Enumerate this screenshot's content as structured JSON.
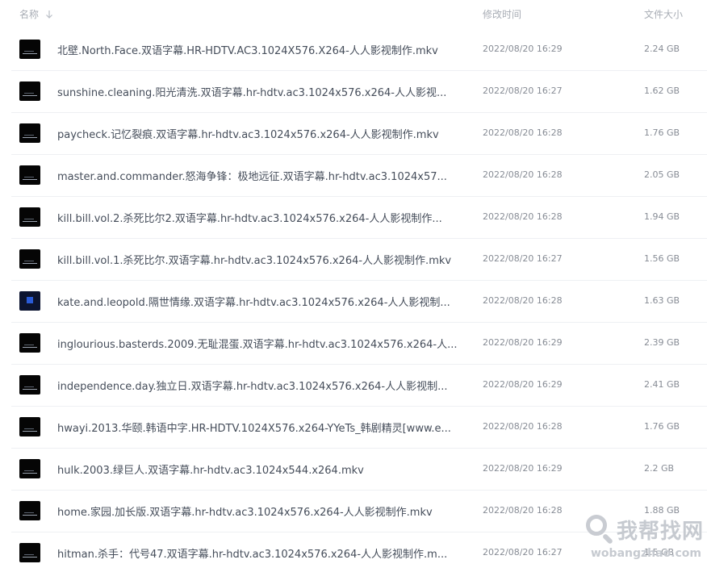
{
  "header": {
    "name_label": "名称",
    "time_label": "修改时间",
    "size_label": "文件大小"
  },
  "files": [
    {
      "name": "北壁.North.Face.双语字幕.HR-HDTV.AC3.1024X576.X264-人人影视制作.mkv",
      "time": "2022/08/20 16:29",
      "size": "2.24 GB",
      "thumb": "dark"
    },
    {
      "name": "sunshine.cleaning.阳光清洗.双语字幕.hr-hdtv.ac3.1024x576.x264-人人影视...",
      "time": "2022/08/20 16:27",
      "size": "1.62 GB",
      "thumb": "dark"
    },
    {
      "name": "paycheck.记忆裂痕.双语字幕.hr-hdtv.ac3.1024x576.x264-人人影视制作.mkv",
      "time": "2022/08/20 16:28",
      "size": "1.76 GB",
      "thumb": "dark"
    },
    {
      "name": "master.and.commander.怒海争锋：极地远征.双语字幕.hr-hdtv.ac3.1024x57...",
      "time": "2022/08/20 16:28",
      "size": "2.05 GB",
      "thumb": "dark"
    },
    {
      "name": "kill.bill.vol.2.杀死比尔2.双语字幕.hr-hdtv.ac3.1024x576.x264-人人影视制作...",
      "time": "2022/08/20 16:28",
      "size": "1.94 GB",
      "thumb": "dark"
    },
    {
      "name": "kill.bill.vol.1.杀死比尔.双语字幕.hr-hdtv.ac3.1024x576.x264-人人影视制作.mkv",
      "time": "2022/08/20 16:27",
      "size": "1.56 GB",
      "thumb": "dark"
    },
    {
      "name": "kate.and.leopold.隔世情缘.双语字幕.hr-hdtv.ac3.1024x576.x264-人人影视制...",
      "time": "2022/08/20 16:28",
      "size": "1.63 GB",
      "thumb": "blue"
    },
    {
      "name": "inglourious.basterds.2009.无耻混蛋.双语字幕.hr-hdtv.ac3.1024x576.x264-人...",
      "time": "2022/08/20 16:29",
      "size": "2.39 GB",
      "thumb": "dark"
    },
    {
      "name": "independence.day.独立日.双语字幕.hr-hdtv.ac3.1024x576.x264-人人影视制...",
      "time": "2022/08/20 16:29",
      "size": "2.41 GB",
      "thumb": "dark"
    },
    {
      "name": "hwayi.2013.华颐.韩语中字.HR-HDTV.1024X576.x264-YYeTs_韩剧精灵[www.e...",
      "time": "2022/08/20 16:28",
      "size": "1.76 GB",
      "thumb": "dark"
    },
    {
      "name": "hulk.2003.绿巨人.双语字幕.hr-hdtv.ac3.1024x544.x264.mkv",
      "time": "2022/08/20 16:29",
      "size": "2.2 GB",
      "thumb": "dark"
    },
    {
      "name": "home.家园.加长版.双语字幕.hr-hdtv.ac3.1024x576.x264-人人影视制作.mkv",
      "time": "2022/08/20 16:28",
      "size": "1.88 GB",
      "thumb": "dark"
    },
    {
      "name": "hitman.杀手：代号47.双语字幕.hr-hdtv.ac3.1024x576.x264-人人影视制作.m...",
      "time": "2022/08/20 16:27",
      "size": "1.5 GB",
      "thumb": "dark"
    }
  ],
  "watermark": {
    "text": "我帮找网",
    "url": "wobangzhao.com"
  }
}
